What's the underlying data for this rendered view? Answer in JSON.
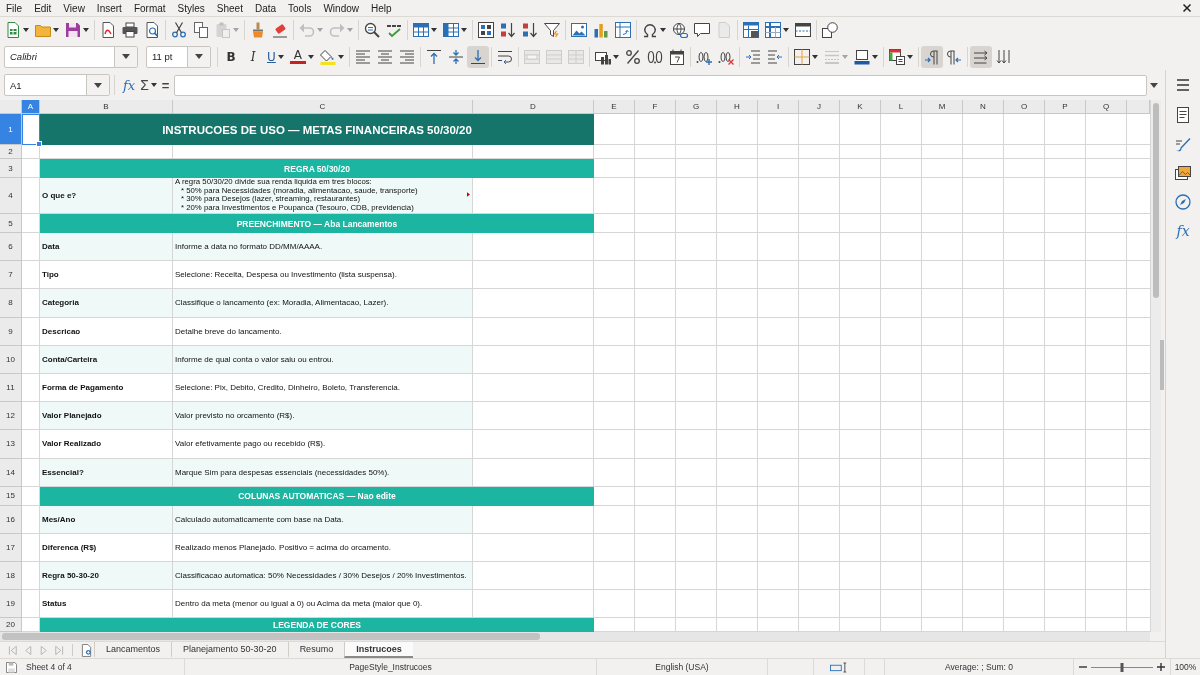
{
  "menu": [
    "File",
    "Edit",
    "View",
    "Insert",
    "Format",
    "Styles",
    "Sheet",
    "Data",
    "Tools",
    "Window",
    "Help"
  ],
  "standard_toolbar": {
    "paste": {
      "disabled": true
    },
    "undo": {
      "disabled": true
    },
    "redo": {
      "disabled": true
    },
    "headers_footers": {
      "disabled": true
    }
  },
  "formatting_toolbar": {
    "font_name": "Calibri",
    "font_size": "11 pt",
    "style_buttons": [
      {
        "kind": "bold",
        "label": "B"
      },
      {
        "kind": "italic",
        "label": "I"
      },
      {
        "kind": "underline",
        "label": "U"
      }
    ],
    "font_color": {
      "label": "A"
    },
    "align_top": {
      "on": false
    },
    "align_middle": {
      "on": false
    },
    "align_bottom": {
      "on": true
    },
    "merge": {
      "disabled": true
    },
    "border_style": {
      "disabled": true
    },
    "left_to_right": {
      "on": true
    },
    "right_to_left": {
      "on": false
    },
    "text_left_to_right": {
      "on": true
    },
    "text_top_to_bottom": {
      "on": false
    }
  },
  "formula_bar": {
    "name_box": "A1",
    "function_wizard": "fx",
    "sum": "Σ",
    "equals": "="
  },
  "sidebar": {
    "functions": "fx"
  },
  "sheet": {
    "columns": [
      {
        "label": "A",
        "selected": true
      },
      {
        "label": "B",
        "selected": false
      },
      {
        "label": "C",
        "selected": false
      },
      {
        "label": "D",
        "selected": false
      },
      {
        "label": "E",
        "selected": false
      },
      {
        "label": "F",
        "selected": false
      },
      {
        "label": "G",
        "selected": false
      },
      {
        "label": "H",
        "selected": false
      },
      {
        "label": "I",
        "selected": false
      },
      {
        "label": "J",
        "selected": false
      },
      {
        "label": "K",
        "selected": false
      },
      {
        "label": "L",
        "selected": false
      },
      {
        "label": "M",
        "selected": false
      },
      {
        "label": "N",
        "selected": false
      },
      {
        "label": "O",
        "selected": false
      },
      {
        "label": "P",
        "selected": false
      },
      {
        "label": "Q",
        "selected": false
      }
    ],
    "rows": [
      {
        "number": "1",
        "selected": true,
        "kind": "title",
        "text": "INSTRUCOES DE USO — METAS FINANCEIRAS 50/30/20"
      },
      {
        "number": "2",
        "selected": false,
        "kind": "blank"
      },
      {
        "number": "3",
        "selected": false,
        "kind": "section",
        "text": "REGRA 50/30/20"
      },
      {
        "number": "4",
        "selected": false,
        "kind": "multiline",
        "shaded": true,
        "label": "O que e?",
        "lines": [
          "A regra 50/30/20 divide sua renda liquida em tres blocos:",
          "* 50% para Necessidades (moradia, alimentacao, saude, transporte)",
          "* 30% para Desejos (lazer, streaming, restaurantes)",
          "* 20% para Investimentos e Poupanca (Tesouro, CDB, previdencia)"
        ],
        "overflow": true
      },
      {
        "number": "5",
        "selected": false,
        "kind": "section",
        "text": "PREENCHIMENTO — Aba Lancamentos"
      },
      {
        "number": "6",
        "selected": false,
        "kind": "field",
        "shaded": true,
        "label": "Data",
        "text": "Informe a data no formato DD/MM/AAAA."
      },
      {
        "number": "7",
        "selected": false,
        "kind": "field",
        "shaded": false,
        "label": "Tipo",
        "text": "Selecione: Receita, Despesa ou Investimento (lista suspensa)."
      },
      {
        "number": "8",
        "selected": false,
        "kind": "field",
        "shaded": true,
        "label": "Categoria",
        "text": "Classifique o lancamento (ex: Moradia, Alimentacao, Lazer)."
      },
      {
        "number": "9",
        "selected": false,
        "kind": "field",
        "shaded": false,
        "label": "Descricao",
        "text": "Detalhe breve do lancamento."
      },
      {
        "number": "10",
        "selected": false,
        "kind": "field",
        "shaded": true,
        "label": "Conta/Carteira",
        "text": "Informe de qual conta o valor saiu ou entrou."
      },
      {
        "number": "11",
        "selected": false,
        "kind": "field",
        "shaded": false,
        "label": "Forma de Pagamento",
        "text": "Selecione: Pix, Debito, Credito, Dinheiro, Boleto, Transferencia."
      },
      {
        "number": "12",
        "selected": false,
        "kind": "field",
        "shaded": true,
        "label": "Valor Planejado",
        "text": "Valor previsto no orcamento (R$)."
      },
      {
        "number": "13",
        "selected": false,
        "kind": "field",
        "shaded": false,
        "label": "Valor Realizado",
        "text": "Valor efetivamente pago ou recebido (R$)."
      },
      {
        "number": "14",
        "selected": false,
        "kind": "field",
        "shaded": true,
        "label": "Essencial?",
        "text": "Marque Sim para despesas essenciais (necessidades 50%)."
      },
      {
        "number": "15",
        "selected": false,
        "kind": "section",
        "text": "COLUNAS AUTOMATICAS — Nao edite"
      },
      {
        "number": "16",
        "selected": false,
        "kind": "field",
        "shaded": true,
        "label": "Mes/Ano",
        "text": "Calculado automaticamente com base na Data."
      },
      {
        "number": "17",
        "selected": false,
        "kind": "field",
        "shaded": false,
        "label": "Diferenca (R$)",
        "text": "Realizado menos Planejado. Positivo = acima do orcamento."
      },
      {
        "number": "18",
        "selected": false,
        "kind": "field",
        "shaded": true,
        "label": "Regra 50-30-20",
        "text": "Classificacao automatica: 50% Necessidades / 30% Desejos / 20% Investimentos."
      },
      {
        "number": "19",
        "selected": false,
        "kind": "field",
        "shaded": false,
        "label": "Status",
        "text": "Dentro da meta (menor ou igual a 0) ou Acima da meta (maior que 0)."
      },
      {
        "number": "20",
        "selected": false,
        "kind": "section",
        "text": "LEGENDA DE CORES"
      }
    ]
  },
  "sheet_tabs": {
    "nav_disabled": true,
    "tabs": [
      {
        "label": "Lancamentos",
        "selected": false
      },
      {
        "label": "Planejamento 50-30-20",
        "selected": false
      },
      {
        "label": "Resumo",
        "selected": false
      },
      {
        "label": "Instrucoes",
        "selected": true
      }
    ]
  },
  "status_bar": {
    "sheet": "Sheet 4 of 4",
    "page_style": "PageStyle_Instrucoes",
    "language": "English (USA)",
    "summary": "Average: ; Sum: 0",
    "zoom": {
      "level": 0.5
    },
    "zoom_percent": "100%"
  }
}
